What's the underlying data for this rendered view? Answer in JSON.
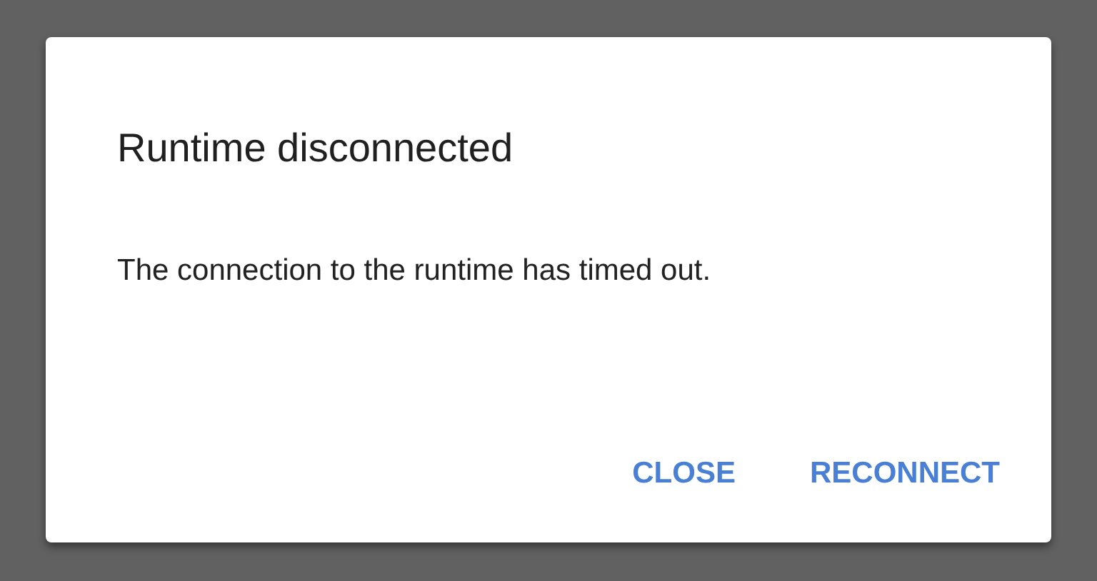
{
  "dialog": {
    "title": "Runtime disconnected",
    "message": "The connection to the runtime has timed out.",
    "buttons": [
      "CLOSE",
      "RECONNECT"
    ]
  }
}
